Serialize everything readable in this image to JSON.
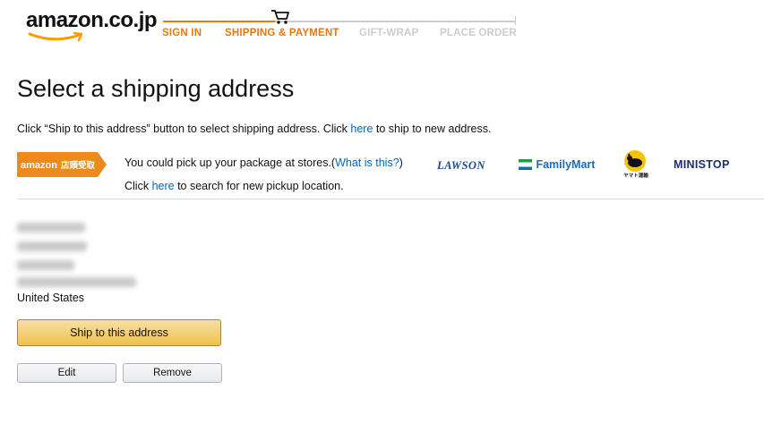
{
  "header": {
    "logo_text": "amazon.co.jp",
    "steps": [
      "SIGN IN",
      "SHIPPING & PAYMENT",
      "GIFT-WRAP",
      "PLACE ORDER"
    ]
  },
  "page": {
    "title": "Select a shipping address",
    "intro_before": "Click “Ship to this address” button to select shipping address. Click ",
    "intro_link": "here",
    "intro_after": " to ship to new address."
  },
  "pickup": {
    "badge_brand": "amazon",
    "badge_label": "店頭受取",
    "line1_before": "You could pick up your package at stores.(",
    "line1_link": "What is this?",
    "line1_after": ")",
    "line2_before": "Click ",
    "line2_link": "here",
    "line2_after": " to search for new pickup location.",
    "stores": [
      "LAWSON",
      "FamilyMart",
      "ヤマト運輸",
      "MINISTOP"
    ]
  },
  "address": {
    "country": "United States",
    "ship_button": "Ship to this address",
    "edit_button": "Edit",
    "remove_button": "Remove"
  },
  "colors": {
    "accent_orange": "#e47911",
    "link_blue": "#0066c0",
    "ship_button_yellow": "#f0c14b"
  }
}
